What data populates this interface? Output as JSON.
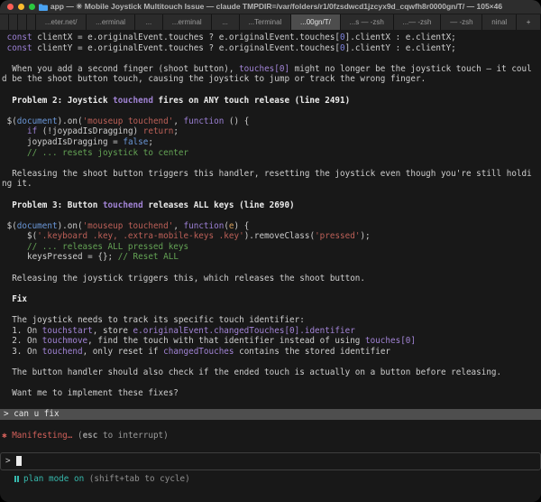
{
  "window": {
    "title": "app — ✳ Mobile Joystick Multitouch Issue — claude TMPDIR=/var/folders/r1/0fzsdwcd1jzcyx9d_cqwfh8r0000gn/T/ — 105×46"
  },
  "tab_bar": {
    "tabs": [
      {
        "label": "",
        "kind": "narrow"
      },
      {
        "label": "",
        "kind": "narrow"
      },
      {
        "label": "",
        "kind": "narrow"
      },
      {
        "label": "",
        "kind": "narrow"
      },
      {
        "label": "...eter.net/",
        "kind": "normal"
      },
      {
        "label": "...erminal",
        "kind": "normal"
      },
      {
        "label": "...",
        "kind": "small"
      },
      {
        "label": "...erminal",
        "kind": "normal"
      },
      {
        "label": "...",
        "kind": "small"
      },
      {
        "label": "...Terminal",
        "kind": "normal"
      },
      {
        "label": "...00gn/T/",
        "kind": "active"
      },
      {
        "label": "...s — -zsh",
        "kind": "normal"
      },
      {
        "label": "...— -zsh",
        "kind": "normal"
      },
      {
        "label": "— -zsh",
        "kind": "normal"
      },
      {
        "label": "ninal",
        "kind": "normal"
      },
      {
        "label": "+",
        "kind": "plus"
      }
    ]
  },
  "colors": {
    "background": "#181818",
    "accent_purple": "#a284d6",
    "string_red": "#bd6058",
    "comment_green": "#64a355",
    "spinner_red": "#d2605a",
    "plan_teal": "#36b8ac",
    "user_row_bg": "#4e4e4e"
  },
  "terminal": {
    "lines": [
      {
        "seg": [
          [
            "k",
            " const"
          ],
          [
            "d",
            " clientX = e.originalEvent.touches ? e.originalEvent.touches["
          ],
          [
            "n",
            "0"
          ],
          [
            "d",
            "].clientX : e.clientX;"
          ]
        ]
      },
      {
        "seg": [
          [
            "k",
            " const"
          ],
          [
            "d",
            " clientY = e.originalEvent.touches ? e.originalEvent.touches["
          ],
          [
            "n",
            "0"
          ],
          [
            "d",
            "].clientY : e.clientY;"
          ]
        ]
      },
      {},
      {
        "seg": [
          [
            "d",
            "  When you add a second finger (shoot button), "
          ],
          [
            "c",
            "touches[0]"
          ],
          [
            "d",
            " might no longer be the joystick touch — it coul"
          ]
        ]
      },
      {
        "seg": [
          [
            "d",
            "d be the shoot button touch, causing the joystick to jump or track the wrong finger."
          ]
        ]
      },
      {},
      {
        "seg": [
          [
            "b",
            "  Problem 2: Joystick "
          ],
          [
            "cb",
            "touchend"
          ],
          [
            "b",
            " fires on ANY touch release (line 2491)"
          ]
        ]
      },
      {},
      {
        "seg": [
          [
            "d",
            " $("
          ],
          [
            "bl",
            "document"
          ],
          [
            "d",
            ").on("
          ],
          [
            "s",
            "'mouseup touchend'"
          ],
          [
            "d",
            ", "
          ],
          [
            "k",
            "function"
          ],
          [
            "d",
            " () {"
          ]
        ]
      },
      {
        "seg": [
          [
            "d",
            "     "
          ],
          [
            "k",
            "if"
          ],
          [
            "d",
            " (!joypadIsDragging) "
          ],
          [
            "s",
            "return"
          ],
          [
            "d",
            ";"
          ]
        ]
      },
      {
        "seg": [
          [
            "d",
            "     joypadIsDragging = "
          ],
          [
            "bl",
            "false"
          ],
          [
            "d",
            ";"
          ]
        ]
      },
      {
        "seg": [
          [
            "g",
            "     // ... resets joystick to center"
          ]
        ]
      },
      {},
      {
        "seg": [
          [
            "d",
            "  Releasing the shoot button triggers this handler, resetting the joystick even though you're still holdi"
          ]
        ]
      },
      {
        "seg": [
          [
            "d",
            "ng it."
          ]
        ]
      },
      {},
      {
        "seg": [
          [
            "b",
            "  Problem 3: Button "
          ],
          [
            "cb",
            "touchend"
          ],
          [
            "b",
            " releases ALL keys (line 2690)"
          ]
        ]
      },
      {},
      {
        "seg": [
          [
            "d",
            " $("
          ],
          [
            "bl",
            "document"
          ],
          [
            "d",
            ").on("
          ],
          [
            "s",
            "'mouseup touchend'"
          ],
          [
            "d",
            ", "
          ],
          [
            "k",
            "function"
          ],
          [
            "d",
            "("
          ],
          [
            "o",
            "e"
          ],
          [
            "d",
            ") {"
          ]
        ]
      },
      {
        "seg": [
          [
            "d",
            "     $("
          ],
          [
            "s",
            "'.keyboard .key, .extra-mobile-keys .key'"
          ],
          [
            "d",
            ").removeClass("
          ],
          [
            "s",
            "'pressed'"
          ],
          [
            "d",
            ");"
          ]
        ]
      },
      {
        "seg": [
          [
            "g",
            "     // ... releases ALL pressed keys"
          ]
        ]
      },
      {
        "seg": [
          [
            "d",
            "     keysPressed = {}; "
          ],
          [
            "g",
            "// Reset ALL"
          ]
        ]
      },
      {},
      {
        "seg": [
          [
            "d",
            "  Releasing the joystick triggers this, which releases the shoot button."
          ]
        ]
      },
      {},
      {
        "seg": [
          [
            "b",
            "  Fix"
          ]
        ]
      },
      {},
      {
        "seg": [
          [
            "d",
            "  The joystick needs to track its specific touch identifier:"
          ]
        ]
      },
      {
        "seg": [
          [
            "d",
            "  1. On "
          ],
          [
            "c",
            "touchstart"
          ],
          [
            "d",
            ", store "
          ],
          [
            "c",
            "e.originalEvent.changedTouches[0].identifier"
          ]
        ]
      },
      {
        "seg": [
          [
            "d",
            "  2. On "
          ],
          [
            "c",
            "touchmove"
          ],
          [
            "d",
            ", find the touch with that identifier instead of using "
          ],
          [
            "c",
            "touches[0]"
          ]
        ]
      },
      {
        "seg": [
          [
            "d",
            "  3. On "
          ],
          [
            "c",
            "touchend"
          ],
          [
            "d",
            ", only reset if "
          ],
          [
            "c",
            "changedTouches"
          ],
          [
            "d",
            " contains the stored identifier"
          ]
        ]
      },
      {},
      {
        "seg": [
          [
            "d",
            "  The button handler should also check if the ended touch is actually on a button before releasing."
          ]
        ]
      },
      {},
      {
        "seg": [
          [
            "d",
            "  Want me to implement these fixes?"
          ]
        ]
      },
      {},
      {
        "type": "user",
        "text": "> can u fix"
      },
      {},
      {
        "seg": [
          [
            "r",
            "✱ Manifesting… "
          ],
          [
            "gr",
            "("
          ],
          [
            "grb",
            "esc"
          ],
          [
            "gr",
            " to interrupt)"
          ]
        ]
      },
      {}
    ],
    "user_message": "> can u fix",
    "prompt": {
      "symbol": ">"
    },
    "status": {
      "icon": "pause-icon",
      "label": "plan mode on",
      "hint": "(shift+tab to cycle)"
    }
  }
}
